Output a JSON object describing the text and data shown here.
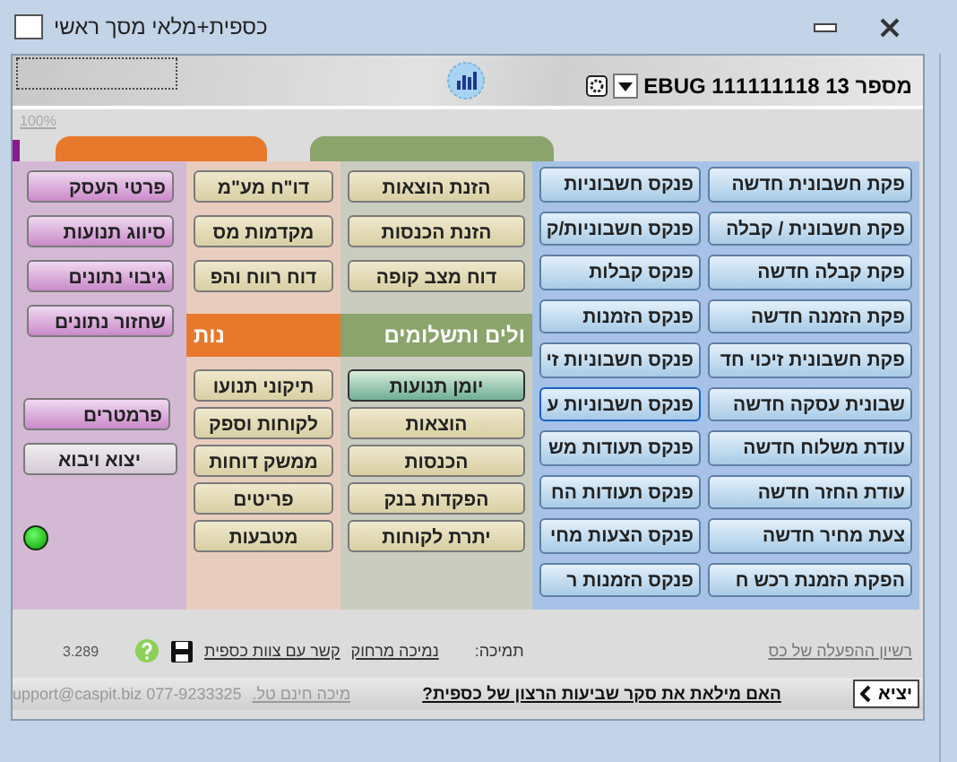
{
  "window": {
    "title": "כספית+מלאי מסך ראשי"
  },
  "header": {
    "account_label": "מספר 13 111111118 EBUG",
    "zoom_label": "100%"
  },
  "blue_column": {
    "right_buttons": [
      {
        "label": "פקת חשבונית חדשה"
      },
      {
        "label": "פקת חשבונית / קבלה"
      },
      {
        "label": "פקת קבלה חדשה"
      },
      {
        "label": "פקת הזמנה חדשה"
      },
      {
        "label": "פקת חשבונית זיכוי חד"
      },
      {
        "label": "שבונית עסקה חדשה"
      },
      {
        "label": "עודת משלוח חדשה"
      },
      {
        "label": "עודת החזר חדשה"
      },
      {
        "label": "צעת מחיר חדשה"
      },
      {
        "label": "הפקת הזמנת רכש ח"
      }
    ],
    "left_buttons": [
      {
        "label": "פנקס חשבוניות",
        "focused": false
      },
      {
        "label": "פנקס חשבוניות/ק",
        "focused": false
      },
      {
        "label": "פנקס קבלות",
        "focused": false
      },
      {
        "label": "פנקס הזמנות",
        "focused": false
      },
      {
        "label": "פנקס חשבוניות זי",
        "focused": false
      },
      {
        "label": "פנקס חשבוניות ע",
        "focused": true
      },
      {
        "label": "פנקס תעודות מש",
        "focused": false
      },
      {
        "label": "פנקס תעודות הח",
        "focused": false
      },
      {
        "label": "פנקס הצעות מחי",
        "focused": false
      },
      {
        "label": "פנקס הזמנות ר",
        "focused": false
      }
    ]
  },
  "green_column": {
    "top_buttons": [
      {
        "label": "הזנת הוצאות"
      },
      {
        "label": "הזנת הכנסות"
      },
      {
        "label": "דוח מצב קופה"
      }
    ],
    "heading": "ולים ותשלומים",
    "bottom_buttons": [
      {
        "label": "יומן תנועות",
        "highlighted": true
      },
      {
        "label": "הוצאות",
        "highlighted": false
      },
      {
        "label": "הכנסות",
        "highlighted": false
      },
      {
        "label": "הפקדות בנק",
        "highlighted": false
      },
      {
        "label": "יתרת לקוחות",
        "highlighted": false
      }
    ]
  },
  "orange_column": {
    "top_buttons": [
      {
        "label": "דו\"ח מע\"מ"
      },
      {
        "label": "מקדמות מס"
      },
      {
        "label": "דוח רווח והפ"
      }
    ],
    "heading": "נות",
    "bottom_buttons": [
      {
        "label": "תיקוני תנועו"
      },
      {
        "label": "לקוחות וספק"
      },
      {
        "label": "ממשק דוחות"
      },
      {
        "label": "פריטים"
      },
      {
        "label": "מטבעות"
      }
    ]
  },
  "purple_column": {
    "top_buttons": [
      {
        "label": "פרטי העסק",
        "kind": "pink"
      },
      {
        "label": "סיווג תנועות",
        "kind": "pink"
      },
      {
        "label": "גיבוי נתונים",
        "kind": "pink"
      },
      {
        "label": "שחזור נתונים",
        "kind": "pink"
      }
    ],
    "bottom_buttons": [
      {
        "label": "פרמטרים",
        "kind": "pink"
      },
      {
        "label": "יצוא ויבוא",
        "kind": "plain"
      }
    ]
  },
  "footer": {
    "license_link": "רשיון ההפעלה של כס",
    "support_label": "תמיכה:",
    "remote_support_link": "נמיכה מרחוק",
    "contact_link": "קשר עם צוות כספית",
    "version": "3.289"
  },
  "status_bar": {
    "exit_button": "יציא",
    "survey_link": "האם מילאת את סקר שביעות הרצון של כספית?",
    "phone_support": "מיכה חינם טל.",
    "contact_info": "upport@caspit.biz 077-9233325"
  }
}
